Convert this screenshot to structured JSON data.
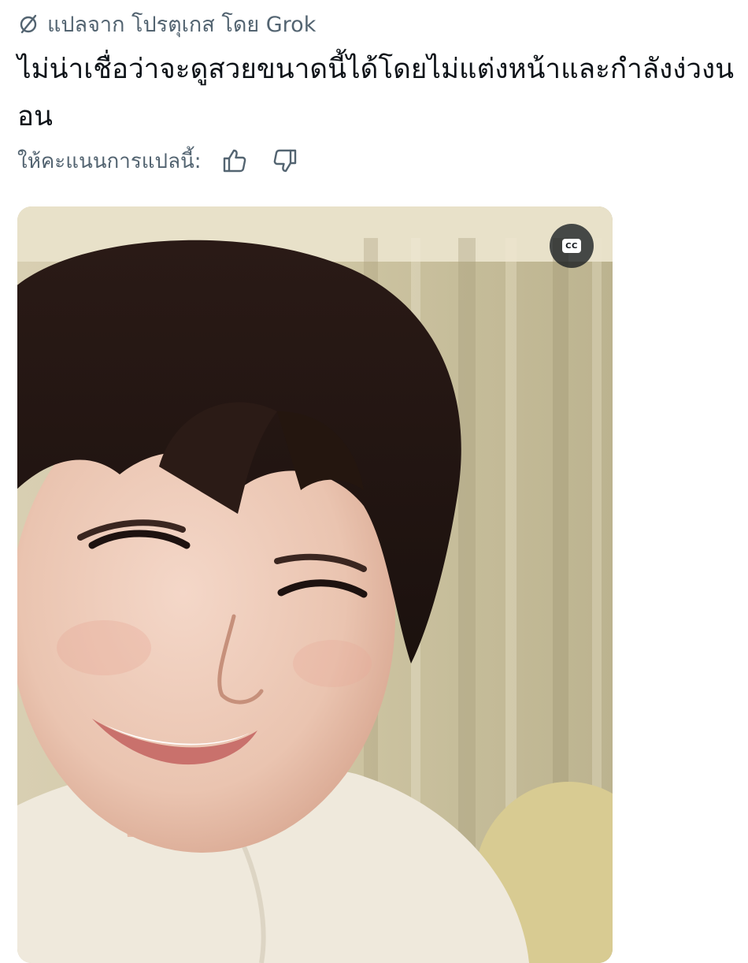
{
  "translation": {
    "icon": "grok-slash-icon",
    "label": "แปลจาก โปรตุเกส โดย Grok"
  },
  "tweet": {
    "text": "ไม่น่าเชื่อว่าจะดูสวยขนาดนี้ได้โดยไม่แต่งหน้าและกำลังง่วงนอน"
  },
  "rating": {
    "label": "ให้คะแนนการแปลนี้:",
    "thumbs_up_icon": "thumbs-up-icon",
    "thumbs_down_icon": "thumbs-down-icon"
  },
  "media": {
    "cc_label": "CC",
    "cc_icon": "closed-captions-icon"
  },
  "colors": {
    "text_primary": "#0f1419",
    "text_secondary": "#536471",
    "background": "#ffffff"
  }
}
